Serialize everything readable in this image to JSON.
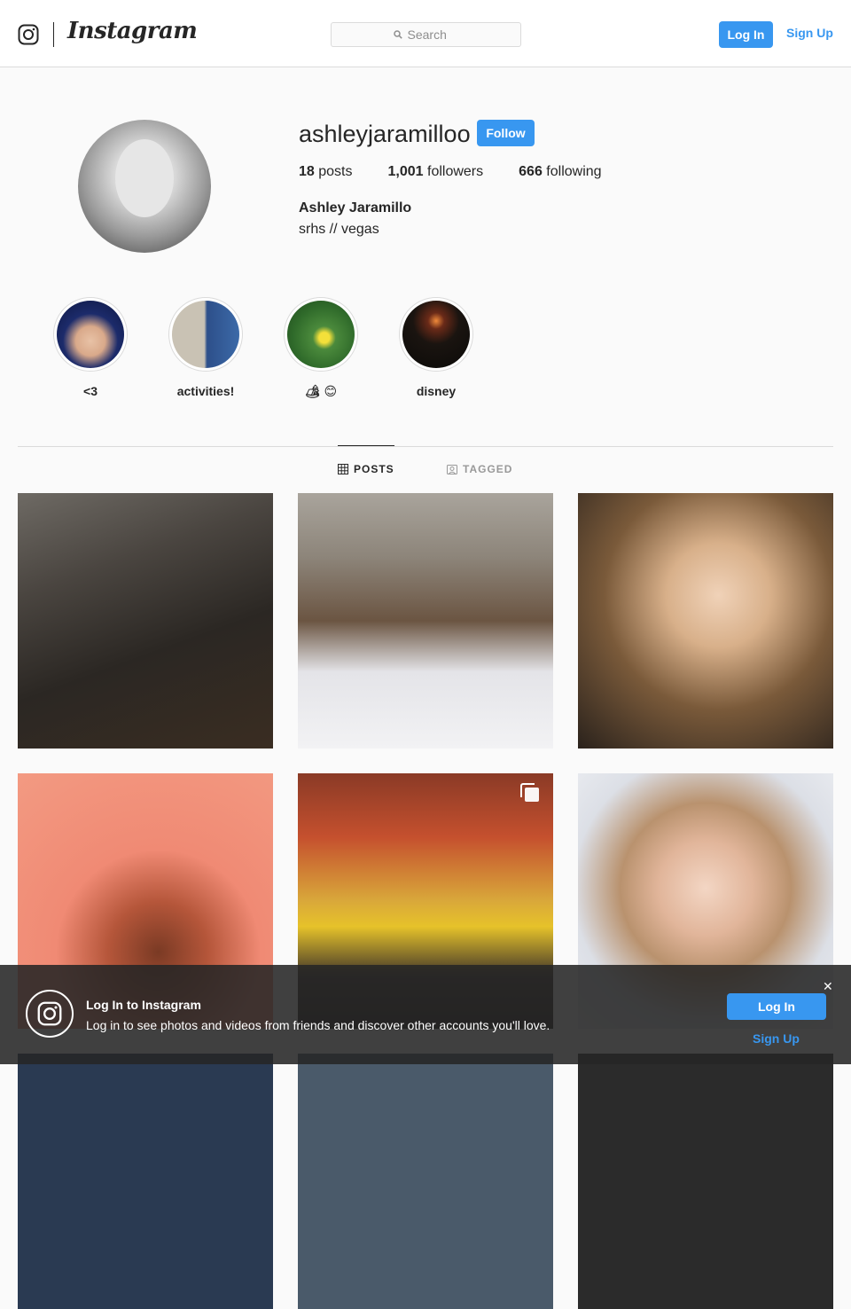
{
  "header": {
    "brand": "Instagram",
    "search_placeholder": "Search",
    "login_label": "Log In",
    "signup_label": "Sign Up"
  },
  "profile": {
    "username": "ashleyjaramilloo",
    "follow_label": "Follow",
    "posts_count": "18",
    "posts_label": "posts",
    "followers_count": "1,001",
    "followers_label": "followers",
    "following_count": "666",
    "following_label": "following",
    "full_name": "Ashley Jaramillo",
    "bio": "srhs // vegas"
  },
  "highlights": [
    {
      "label": "<3"
    },
    {
      "label": "activities!"
    },
    {
      "label": "🏕 😊"
    },
    {
      "label": "disney"
    }
  ],
  "tabs": {
    "posts_label": "POSTS",
    "tagged_label": "TAGGED"
  },
  "banner": {
    "title": "Log In to Instagram",
    "text": "Log in to see photos and videos from friends and discover other accounts you'll love.",
    "close_glyph": "✕",
    "login_label": "Log In",
    "signup_label": "Sign Up"
  },
  "colors": {
    "accent": "#3897f0",
    "background": "#fafafa",
    "text": "#262626"
  }
}
